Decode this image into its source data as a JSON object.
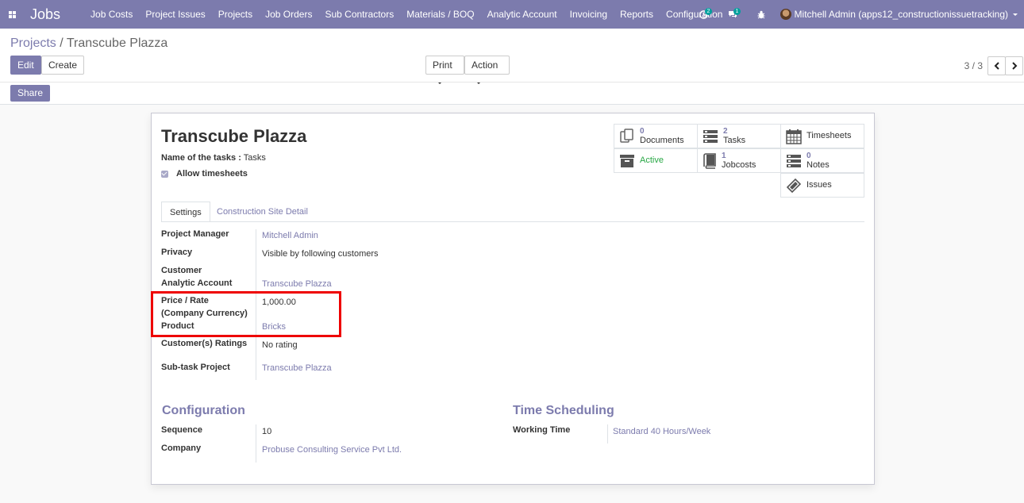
{
  "navbar": {
    "brand": "Jobs",
    "menu": [
      "Job Costs",
      "Project Issues",
      "Projects",
      "Job Orders",
      "Sub Contractors",
      "Materials / BOQ",
      "Analytic Account",
      "Invoicing",
      "Reports",
      "Configuration"
    ],
    "activity_badge": "2",
    "messages_badge": "1",
    "user": "Mitchell Admin (apps12_constructionissuetracking)",
    "accent_color": "#7c7bad"
  },
  "breadcrumb": {
    "parent": "Projects",
    "separator": " / ",
    "current": "Transcube Plazza"
  },
  "buttons": {
    "edit": "Edit",
    "create": "Create",
    "print": "Print",
    "action": "Action",
    "share": "Share"
  },
  "pager": {
    "text": "3 / 3"
  },
  "record": {
    "title": "Transcube Plazza",
    "tasks_label": "Name of the tasks :",
    "tasks_value": "Tasks",
    "allow_timesheets": "Allow timesheets"
  },
  "smart_buttons": {
    "documents": {
      "count": "0",
      "label": "Documents"
    },
    "tasks": {
      "count": "2",
      "label": "Tasks"
    },
    "timesheets": {
      "label": "Timesheets"
    },
    "active": {
      "label": "Active"
    },
    "jobcosts": {
      "count": "1",
      "label": "Jobcosts"
    },
    "notes": {
      "count": "0",
      "label": "Notes"
    },
    "issues": {
      "label": "Issues"
    }
  },
  "tabs": [
    "Settings",
    "Construction Site Detail"
  ],
  "settings": {
    "project_manager": {
      "label": "Project Manager",
      "value": "Mitchell Admin"
    },
    "privacy": {
      "label": "Privacy",
      "value": "Visible by following customers"
    },
    "customer": {
      "label": "Customer"
    },
    "analytic_account": {
      "label": "Analytic Account",
      "value": "Transcube Plazza"
    },
    "price_rate": {
      "label": "Price / Rate",
      "label2": "(Company Currency)",
      "value": "1,000.00"
    },
    "product": {
      "label": "Product",
      "value": "Bricks"
    },
    "ratings": {
      "label": "Customer(s) Ratings",
      "value": "No rating"
    },
    "subtask_project": {
      "label": "Sub-task Project",
      "value": "Transcube Plazza"
    }
  },
  "configuration": {
    "heading": "Configuration",
    "sequence": {
      "label": "Sequence",
      "value": "10"
    },
    "company": {
      "label": "Company",
      "value": "Probuse Consulting Service Pvt Ltd."
    }
  },
  "time_scheduling": {
    "heading": "Time Scheduling",
    "working_time": {
      "label": "Working Time",
      "value": "Standard 40 Hours/Week"
    }
  }
}
